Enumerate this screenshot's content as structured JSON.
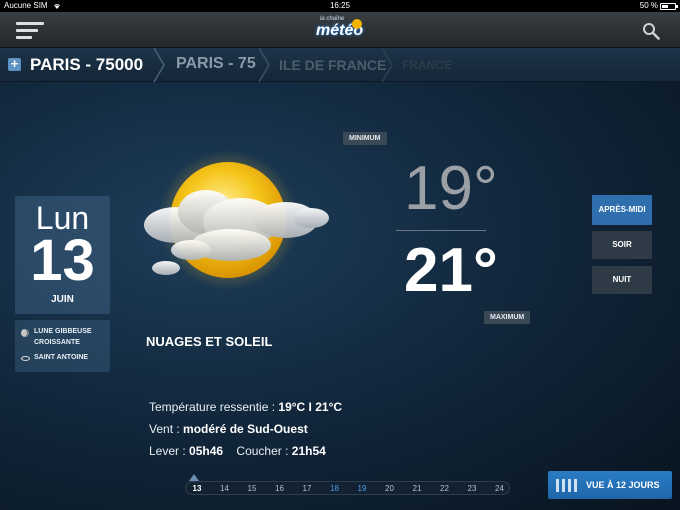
{
  "status_bar": {
    "carrier": "Aucune SIM",
    "time": "16:25",
    "battery": "50 %"
  },
  "header": {
    "logo_small": "la chaîne",
    "logo_main": "météo"
  },
  "breadcrumb": [
    "PARIS - 75000",
    "PARIS - 75",
    "ILE DE FRANCE",
    "FRANCE"
  ],
  "date": {
    "day": "Lun",
    "number": "13",
    "month": "JUIN"
  },
  "ephemeris": {
    "moon_line1": "LUNE GIBBEUSE",
    "moon_line2": "CROISSANTE",
    "saint": "SAINT ANTOINE"
  },
  "weather": {
    "condition": "NUAGES ET SOLEIL",
    "min_label": "MINIMUM",
    "min_temp": "19°",
    "max_temp": "21°",
    "max_label": "MAXIMUM"
  },
  "periods": [
    "APRÈS-MIDI",
    "SOIR",
    "NUIT"
  ],
  "active_period": "APRÈS-MIDI",
  "details": {
    "felt_label": "Température ressentie :",
    "felt_value": "19°C I 21°C",
    "wind_label": "Vent :",
    "wind_value": "modéré de Sud-Ouest",
    "sunrise_label": "Lever :",
    "sunrise_value": "05h46",
    "sunset_label": "Coucher :",
    "sunset_value": "21h54"
  },
  "timeline": {
    "days": [
      "13",
      "14",
      "15",
      "16",
      "17",
      "18",
      "19",
      "20",
      "21",
      "22",
      "23",
      "24"
    ],
    "selected": "13",
    "highlighted": [
      "18",
      "19"
    ]
  },
  "forecast_button": "VUE À 12 JOURS",
  "colors": {
    "accent": "#2f6fae",
    "highlight_day": "#4f9be0",
    "sun": "#f5b400"
  }
}
